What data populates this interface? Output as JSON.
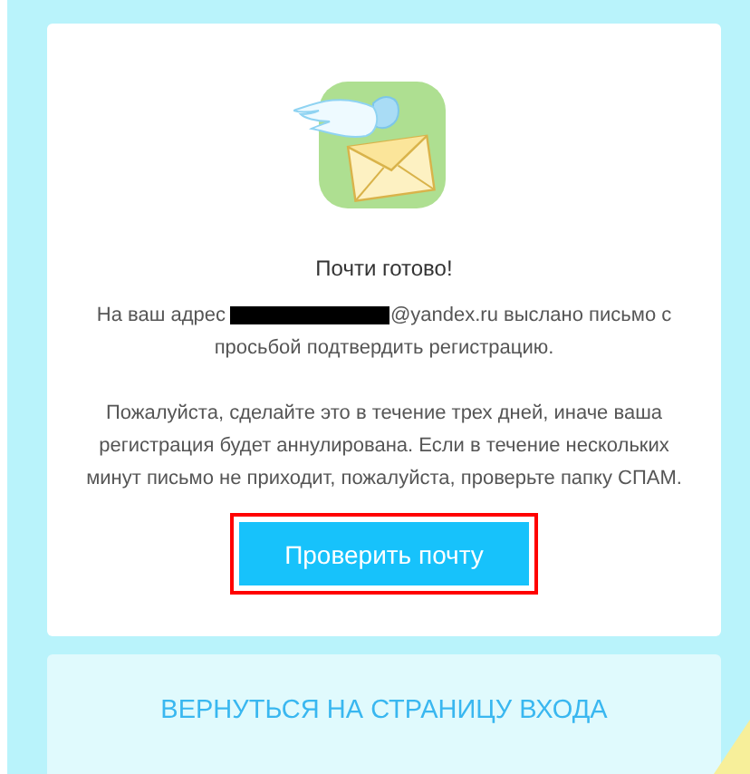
{
  "heading": "Почти готово!",
  "message": {
    "before": "На ваш адрес",
    "redacted": true,
    "after": "@yandex.ru выслано письмо с",
    "continuation": "просьбой подтвердить регистрацию."
  },
  "notice": "Пожалуйста, сделайте это в течение трех дней, иначе ваша регистрация будет аннулирована. Если в течение нескольких минут письмо не приходит, пожалуйста, проверьте папку СПАМ.",
  "button": {
    "label": "Проверить почту",
    "highlighted": true
  },
  "back_link": {
    "label": "ВЕРНУТЬСЯ НА СТРАНИЦУ ВХОДА"
  }
}
